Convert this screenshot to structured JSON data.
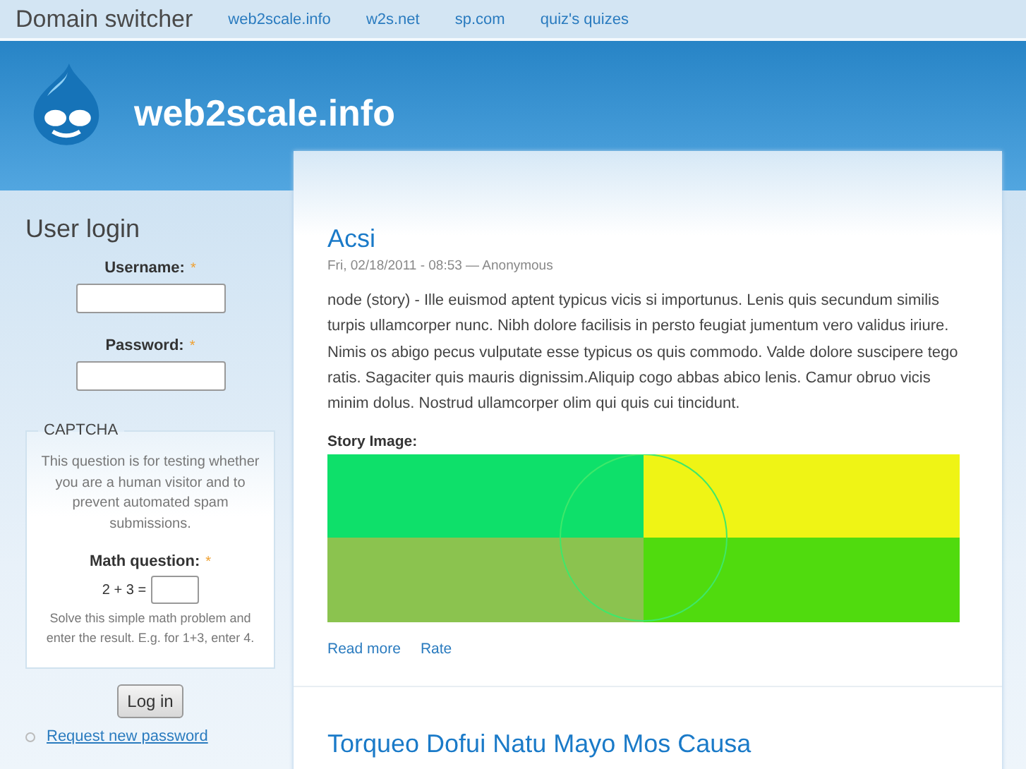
{
  "domain_switcher": {
    "title": "Domain switcher",
    "links": [
      "web2scale.info",
      "w2s.net",
      "sp.com",
      "quiz's quizes"
    ]
  },
  "header": {
    "site_name": "web2scale.info"
  },
  "user_login": {
    "title": "User login",
    "username": {
      "label": "Username:",
      "required_mark": "*"
    },
    "password": {
      "label": "Password:",
      "required_mark": "*"
    },
    "captcha": {
      "legend": "CAPTCHA",
      "description": "This question is for testing whether you are a human visitor and to prevent automated spam submissions.",
      "question_label": "Math question:",
      "required_mark": "*",
      "question": "2 + 3 =",
      "help": "Solve this simple math problem and enter the result. E.g. for 1+3, enter 4."
    },
    "button": "Log in",
    "links": [
      "Request new password"
    ]
  },
  "nodes": [
    {
      "title": "Acsi",
      "meta": "Fri, 02/18/2011 - 08:53 — Anonymous",
      "body": "node (story) - Ille euismod aptent typicus vicis si importunus. Lenis quis secundum similis turpis ullamcorper nunc. Nibh dolore facilisis in persto feugiat jumentum vero validus iriure. Nimis os abigo pecus vulputate esse typicus os quis commodo. Valde dolore suscipere tego ratis. Sagaciter quis mauris dignissim.Aliquip cogo abbas abico lenis. Camur obruo vicis minim dolus. Nostrud ullamcorper olim qui quis cui tincidunt.",
      "image_label": "Story Image:",
      "links": [
        "Read more",
        "Rate"
      ]
    },
    {
      "title": "Torqueo Dofui Natu Mayo Mos Causa"
    }
  ]
}
